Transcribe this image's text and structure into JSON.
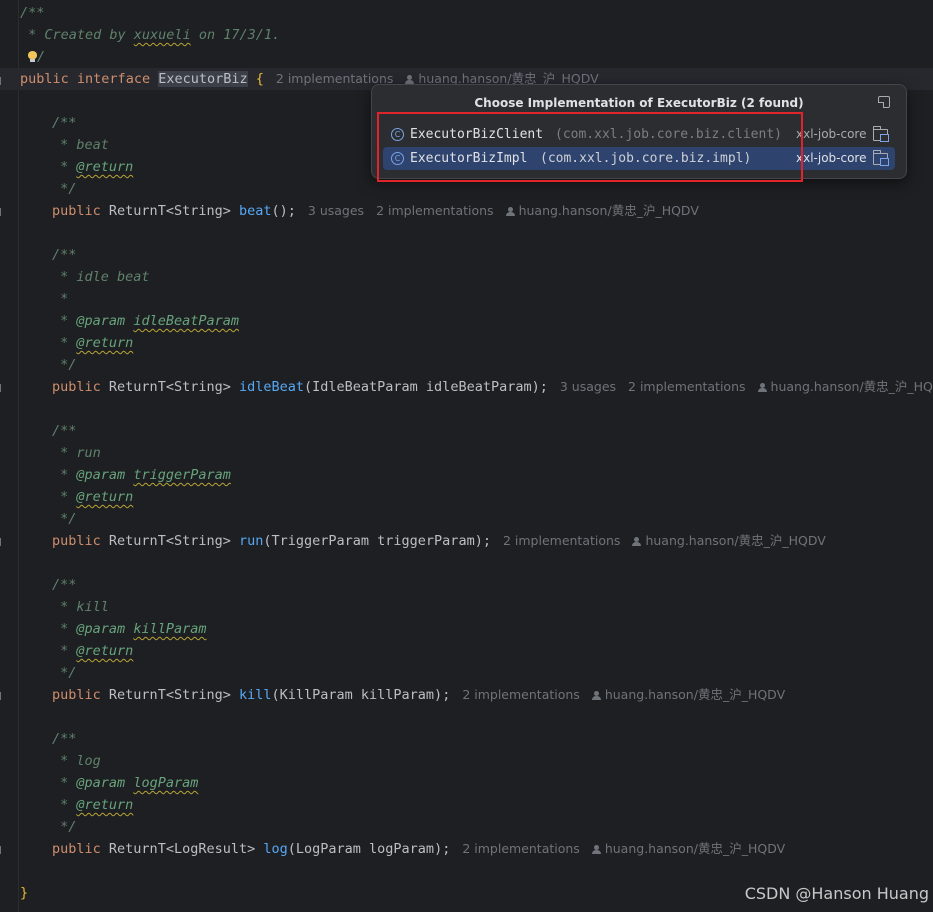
{
  "editor": {
    "header_comment": {
      "open": "/**",
      "created_prefix": " * Created by ",
      "author": "xuxueli",
      "created_suffix": " on 17/3/1.",
      "close": "/"
    },
    "interface_line": {
      "kw_public": "public",
      "kw_interface": "interface",
      "name": "ExecutorBiz",
      "brace": "{",
      "implementations": "2 implementations",
      "author": "huang.hanson/黄忠_沪_HQDV"
    },
    "methods": [
      {
        "doc": [
          {
            "text": "/**"
          },
          {
            "text": " * beat"
          },
          {
            "tag": "@return"
          }
        ],
        "doc_close": " */",
        "kw_public": "public",
        "return_type": "ReturnT<String>",
        "name": "beat",
        "params": "()",
        "end": ";",
        "usages": "3 usages",
        "implementations": "2 implementations",
        "author": "huang.hanson/黄忠_沪_HQDV"
      },
      {
        "kw_public": "public",
        "return_type": "ReturnT<String>",
        "name": "idleBeat",
        "params": "(IdleBeatParam idleBeatParam)",
        "end": ";",
        "usages": "3 usages",
        "implementations": "2 implementations",
        "author": "huang.hanson/黄忠_沪_HQDV",
        "doc_title": " * idle beat",
        "doc_blank": " *",
        "param_tag": "@param",
        "param_name": "idleBeatParam"
      },
      {
        "kw_public": "public",
        "return_type": "ReturnT<String>",
        "name": "run",
        "params": "(TriggerParam triggerParam)",
        "end": ";",
        "implementations": "2 implementations",
        "author": "huang.hanson/黄忠_沪_HQDV",
        "doc_title": " * run",
        "param_tag": "@param",
        "param_name": "triggerParam"
      },
      {
        "kw_public": "public",
        "return_type": "ReturnT<String>",
        "name": "kill",
        "params": "(KillParam killParam)",
        "end": ";",
        "implementations": "2 implementations",
        "author": "huang.hanson/黄忠_沪_HQDV",
        "doc_title": " * kill",
        "param_tag": "@param",
        "param_name": "killParam"
      },
      {
        "kw_public": "public",
        "return_type": "ReturnT<LogResult>",
        "name": "log",
        "params": "(LogParam logParam)",
        "end": ";",
        "implementations": "2 implementations",
        "author": "huang.hanson/黄忠_沪_HQDV",
        "doc_title": " * log",
        "param_tag": "@param",
        "param_name": "logParam"
      }
    ],
    "doc_open": "/**",
    "doc_star": " * ",
    "doc_close": " */",
    "return_tag": "@return",
    "closing_brace": "}"
  },
  "popup": {
    "title": "Choose Implementation of ExecutorBiz (2 found)",
    "items": [
      {
        "icon_letter": "C",
        "name": "ExecutorBizClient",
        "package": "(com.xxl.job.core.biz.client)",
        "module": "xxl-job-core",
        "selected": false
      },
      {
        "icon_letter": "C",
        "name": "ExecutorBizImpl",
        "package": "(com.xxl.job.core.biz.impl)",
        "module": "xxl-job-core",
        "selected": true
      }
    ]
  },
  "icons": {
    "popup_pin": "open-in-tool-window-icon",
    "module_folder": "module-folder-icon",
    "class": "class-icon",
    "intention": "light-bulb-icon",
    "author": "person-icon"
  },
  "colors": {
    "background": "#1e1f22",
    "keyword": "#cf8e6d",
    "function": "#56a8f5",
    "comment": "#5f826b",
    "selection": "#2e436e",
    "highlight_box": "#e0242b"
  },
  "watermark": "CSDN @Hanson Huang"
}
